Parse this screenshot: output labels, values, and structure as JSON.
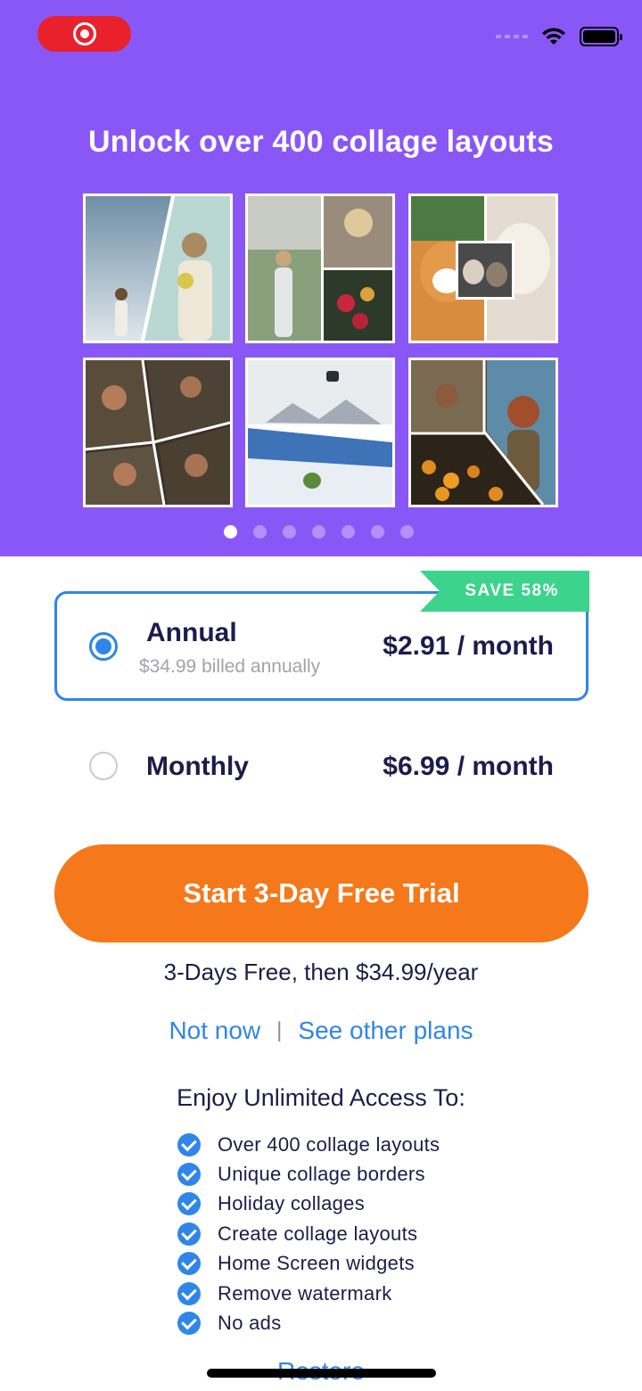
{
  "status_bar": {
    "recording_icon": "recording-indicator-icon",
    "wifi_icon": "wifi-icon",
    "battery_icon": "battery-icon",
    "signal_icon": "cellular-signal-icon"
  },
  "hero": {
    "title": "Unlock over 400 collage layouts",
    "background_color": "#8a57f7",
    "carousel_page_count": 7,
    "carousel_active_index": 0
  },
  "plans": {
    "annual": {
      "name": "Annual",
      "subtitle": "$34.99 billed annually",
      "price": "$2.91 / month",
      "badge": "SAVE 58%",
      "selected": true
    },
    "monthly": {
      "name": "Monthly",
      "price": "$6.99 / month",
      "selected": false
    }
  },
  "cta": {
    "label": "Start 3-Day Free Trial",
    "color": "#f5781b",
    "note": "3-Days Free, then $34.99/year"
  },
  "links": {
    "not_now": "Not now",
    "separator": "|",
    "see_other_plans": "See other plans"
  },
  "benefits": {
    "title": "Enjoy Unlimited Access To:",
    "items": [
      "Over 400 collage layouts",
      "Unique collage borders",
      "Holiday collages",
      "Create collage layouts",
      "Home Screen widgets",
      "Remove watermark",
      "No ads"
    ]
  },
  "restore": "Restore",
  "colors": {
    "accent_blue": "#2f86e8",
    "badge_green": "#3cd38c",
    "text_dark": "#1d1c4a"
  }
}
